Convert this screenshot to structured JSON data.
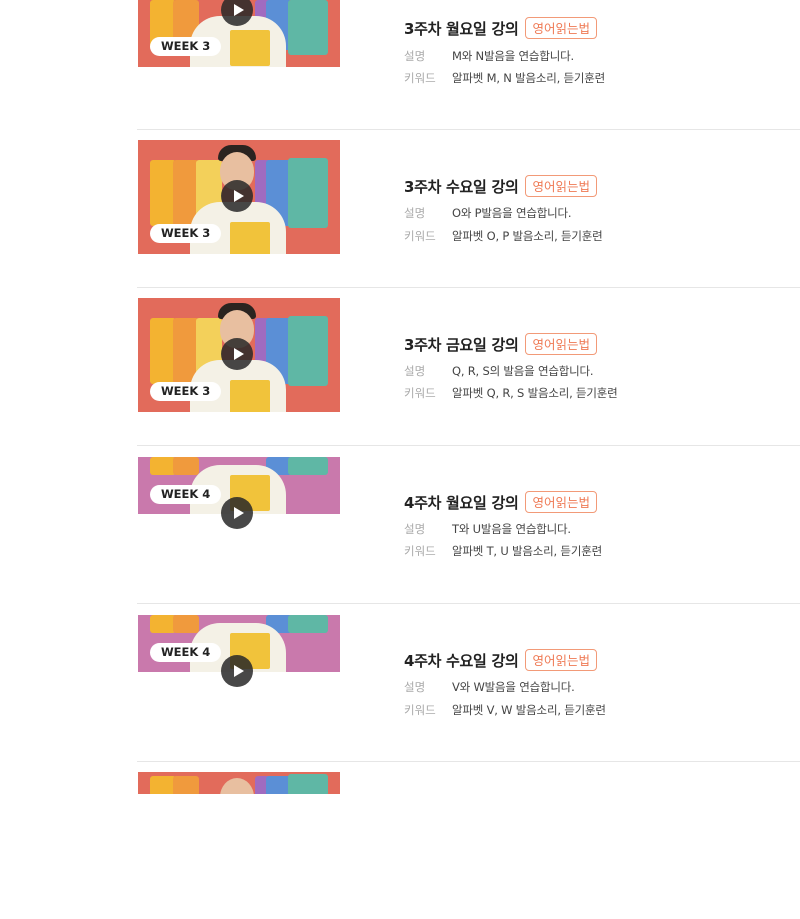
{
  "colors": {
    "accent": "#ef7a55",
    "thumb_week3": "#e26b5b",
    "thumb_week4": "#c979ac",
    "divider": "#e6e6e6"
  },
  "labels": {
    "description": "설명",
    "keywords": "키워드"
  },
  "lectures": [
    {
      "title": "3주차 월요일 강의",
      "tag": "영어읽는법",
      "description": "M와 N발음을 연습합니다.",
      "keywords": "알파벳 M, N 발음소리, 듣기훈련",
      "week_badge": "WEEK 3",
      "play_icon": "play-icon"
    },
    {
      "title": "3주차 수요일 강의",
      "tag": "영어읽는법",
      "description": "O와 P발음을 연습합니다.",
      "keywords": "알파벳 O, P 발음소리, 듣기훈련",
      "week_badge": "WEEK 3",
      "play_icon": "play-icon"
    },
    {
      "title": "3주차 금요일 강의",
      "tag": "영어읽는법",
      "description": "Q, R, S의 발음을 연습합니다.",
      "keywords": "알파벳 Q, R, S 발음소리, 듣기훈련",
      "week_badge": "WEEK 3",
      "play_icon": "play-icon"
    },
    {
      "title": "4주차 월요일 강의",
      "tag": "영어읽는법",
      "description": "T와 U발음을 연습합니다.",
      "keywords": "알파벳 T, U 발음소리, 듣기훈련",
      "week_badge": "WEEK 4",
      "play_icon": "play-icon"
    },
    {
      "title": "4주차 수요일 강의",
      "tag": "영어읽는법",
      "description": "V와 W발음을 연습합니다.",
      "keywords": "알파벳 V, W 발음소리, 듣기훈련",
      "week_badge": "WEEK 4",
      "play_icon": "play-icon"
    }
  ]
}
